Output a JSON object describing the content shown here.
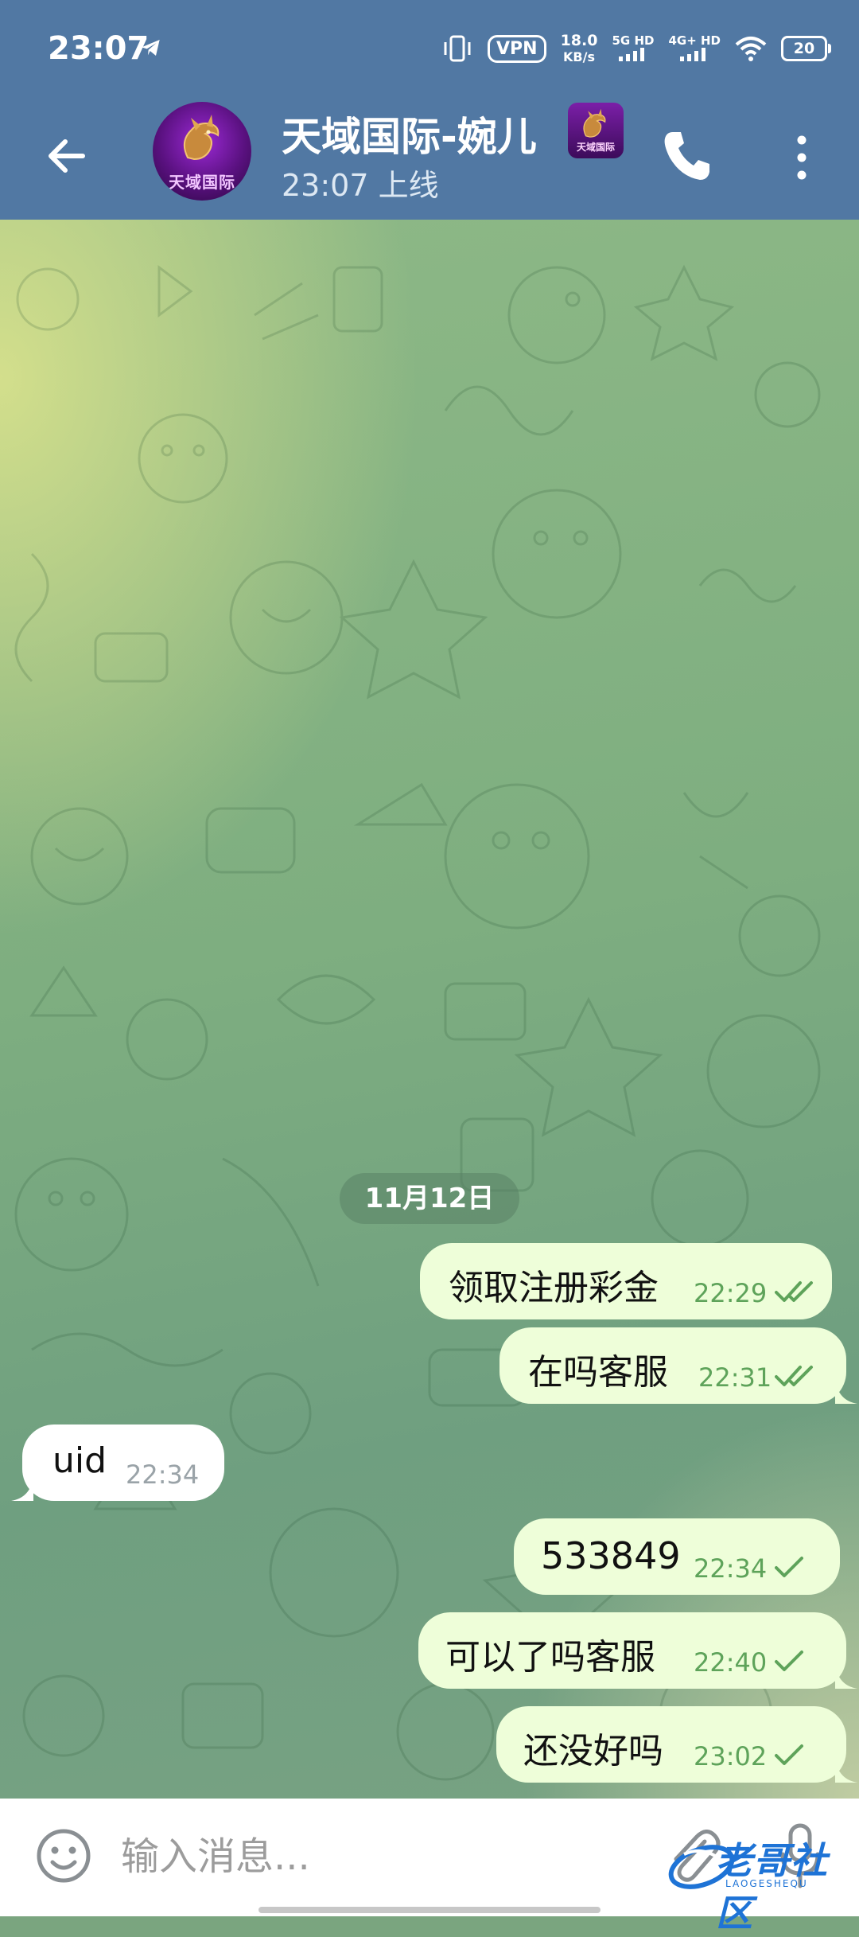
{
  "status_bar": {
    "time": "23:07",
    "vpn": "VPN",
    "speed_value": "18.0",
    "speed_unit": "KB/s",
    "network1": "5G HD",
    "network2": "4G+ HD",
    "battery": "20"
  },
  "header": {
    "title": "天域国际-婉儿",
    "subtitle": "23:07 上线",
    "avatar_text": "天域国际",
    "badge_text": "天域国际"
  },
  "chat": {
    "date_label": "11月12日",
    "messages": [
      {
        "text": "领取注册彩金",
        "time": "22:29",
        "direction": "outgoing",
        "status": "read"
      },
      {
        "text": "在吗客服",
        "time": "22:31",
        "direction": "outgoing",
        "status": "read"
      },
      {
        "text": "uid",
        "time": "22:34",
        "direction": "incoming"
      },
      {
        "text": "533849",
        "time": "22:34",
        "direction": "outgoing",
        "status": "sent"
      },
      {
        "text": "可以了吗客服",
        "time": "22:40",
        "direction": "outgoing",
        "status": "sent"
      },
      {
        "text": "还没好吗",
        "time": "23:02",
        "direction": "outgoing",
        "status": "sent"
      }
    ]
  },
  "input": {
    "placeholder": "输入消息...",
    "value": ""
  },
  "watermark": {
    "text": "老哥社区",
    "sub": "LAOGESHEQU"
  },
  "colors": {
    "header_bg": "#5178a3",
    "outgoing_bubble": "#eefed9",
    "incoming_bubble": "#ffffff",
    "tick_color": "#5ea35a"
  },
  "icons": {
    "back": "arrow-left-icon",
    "call": "phone-icon",
    "menu": "more-vertical-icon",
    "emoji": "smiley-icon",
    "attach": "paperclip-icon",
    "mic": "microphone-icon"
  }
}
